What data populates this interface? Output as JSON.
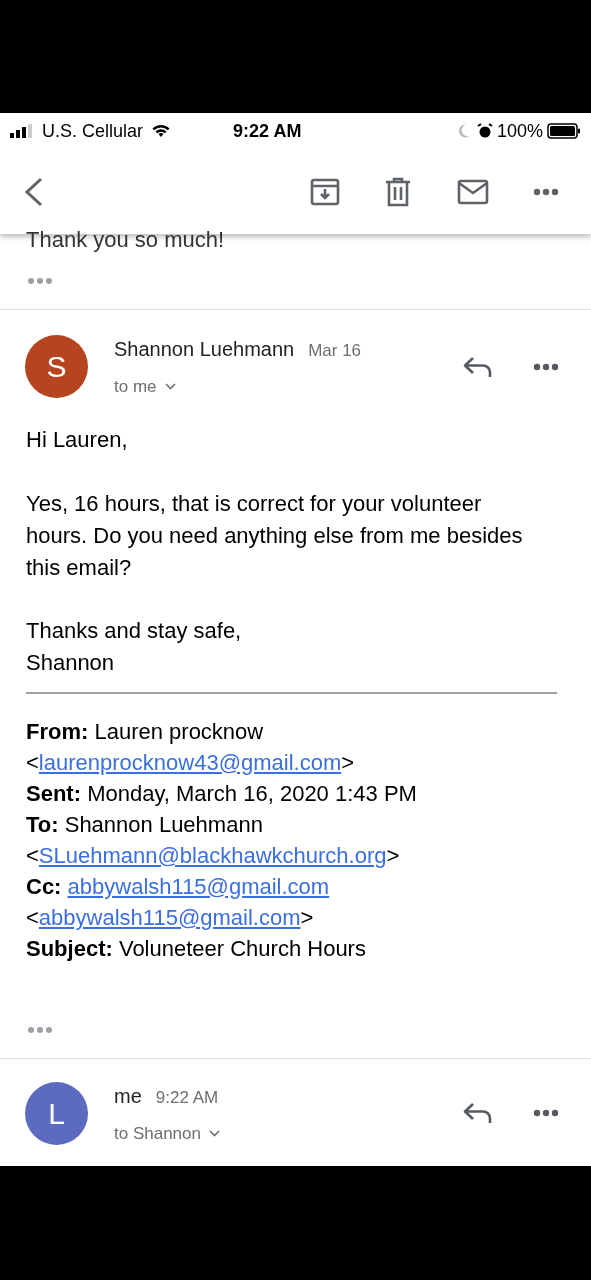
{
  "status_bar": {
    "carrier": "U.S. Cellular",
    "time": "9:22 AM",
    "battery": "100%"
  },
  "previous_message": {
    "last_line": "Thank you so much!"
  },
  "messages": [
    {
      "avatar_letter": "S",
      "color": "#b5441f",
      "sender": "Shannon Luehmann",
      "date": "Mar 16",
      "recipients": "to me",
      "greeting": "Hi Lauren,",
      "body": "Yes, 16 hours, that is correct for your volunteer hours. Do you need anything else from me besides this email?",
      "closing": "Thanks and stay safe,",
      "signature": "Shannon",
      "quoted_header": [
        {
          "label": "From:",
          "value": "Lauren procknow",
          "open": "<",
          "link": "laurenprocknow43@gmail.com",
          "close": ">"
        },
        {
          "label": "Sent:",
          "value": "Monday, March 16, 2020 1:43 PM"
        },
        {
          "label": "To:",
          "value": "Shannon Luehmann",
          "open": "<",
          "link": "SLuehmann@blackhawkchurch.org",
          "close": ">"
        },
        {
          "label": "Cc:",
          "value_link": "abbywalsh115@gmail.com",
          "open": "<",
          "link": "abbywalsh115@gmail.com",
          "close": ">"
        },
        {
          "label": "Subject:",
          "value": "Voluneteer Church Hours"
        }
      ]
    },
    {
      "avatar_letter": "L",
      "color": "#5c6bc0",
      "sender": "me",
      "date": "9:22 AM",
      "recipients": "to Shannon"
    }
  ]
}
